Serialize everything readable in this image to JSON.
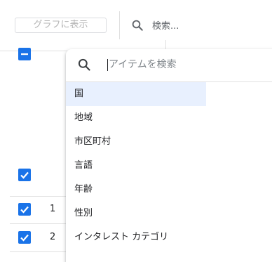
{
  "toolbar": {
    "chart_button_label": "グラフに表示",
    "search_placeholder": "検索..."
  },
  "table": {
    "rows": [
      {
        "number": "1"
      },
      {
        "number": "2"
      },
      {
        "number": ""
      }
    ]
  },
  "dropdown": {
    "search_placeholder": "アイテムを検索",
    "items": [
      {
        "label": "国",
        "selected": true
      },
      {
        "label": "地域",
        "selected": false
      },
      {
        "label": "市区町村",
        "selected": false
      },
      {
        "label": "言語",
        "selected": false
      },
      {
        "label": "年齢",
        "selected": false
      },
      {
        "label": "性別",
        "selected": false
      },
      {
        "label": "インタレスト カテゴリ",
        "selected": false
      }
    ]
  },
  "colors": {
    "accent": "#1a73e8",
    "selected_bg": "#e8f0fe",
    "divider": "#e0e0e0"
  },
  "icons": {
    "search": "search-icon",
    "checkbox_checked": "checkbox-checked-icon",
    "checkbox_indeterminate": "checkbox-indeterminate-icon"
  }
}
